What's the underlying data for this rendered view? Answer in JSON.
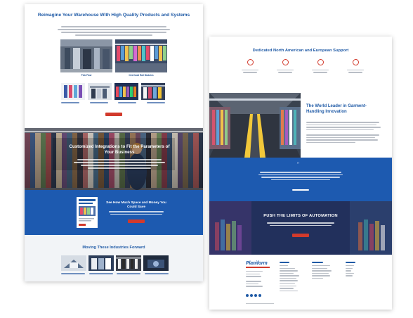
{
  "left_page": {
    "heading": "Reimagine Your Warehouse With High Quality Products and Systems",
    "top_captions": [
      "Pick Flow",
      "Overhead Rail Modules"
    ],
    "small_captions": [
      "",
      "",
      "",
      ""
    ],
    "cta_label": "",
    "hero_title": "Customized Integrations to Fit the Parameters of Your Business",
    "guide_title": "See How Much Space and Money You Could Save",
    "guide_cta_label": "",
    "industries_title": "Moving These Industries Forward",
    "industry_captions": [
      "",
      "",
      "",
      ""
    ]
  },
  "right_page": {
    "heading": "Dedicated North American and European Support",
    "feature_labels": [
      "",
      "",
      "",
      ""
    ],
    "leader_title": "The World Leader in Garment-Handling Innovation",
    "quote_mark": "“",
    "push_title": "PUSH THE LIMITS OF AUTOMATION",
    "logo_text": "Planiform"
  },
  "colors": {
    "brand_blue": "#1f5aa6",
    "band_blue": "#1d5ab0",
    "accent_red": "#d23a2c"
  },
  "icons": [
    "support-icon",
    "warehouse-icon",
    "gear-icon",
    "globe-icon"
  ]
}
